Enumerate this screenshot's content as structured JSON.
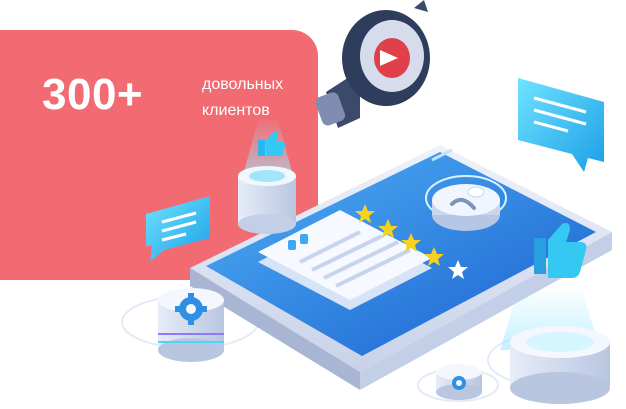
{
  "headline": {
    "number": "300+",
    "line1": "довольных",
    "line2": "клиентов"
  },
  "colors": {
    "card": "#f26a72",
    "screen": "#1e6fd9",
    "star": "#f4d21e",
    "cyan": "#35c8f2",
    "megaphone": "#2f3d5c"
  },
  "rating": {
    "filled_stars": 4,
    "total_stars": 5
  },
  "icons": [
    "megaphone-icon",
    "chat-bubble-icon",
    "thumbs-up-icon",
    "gear-icon",
    "user-profile-icon",
    "star-icon",
    "quote-icon"
  ]
}
